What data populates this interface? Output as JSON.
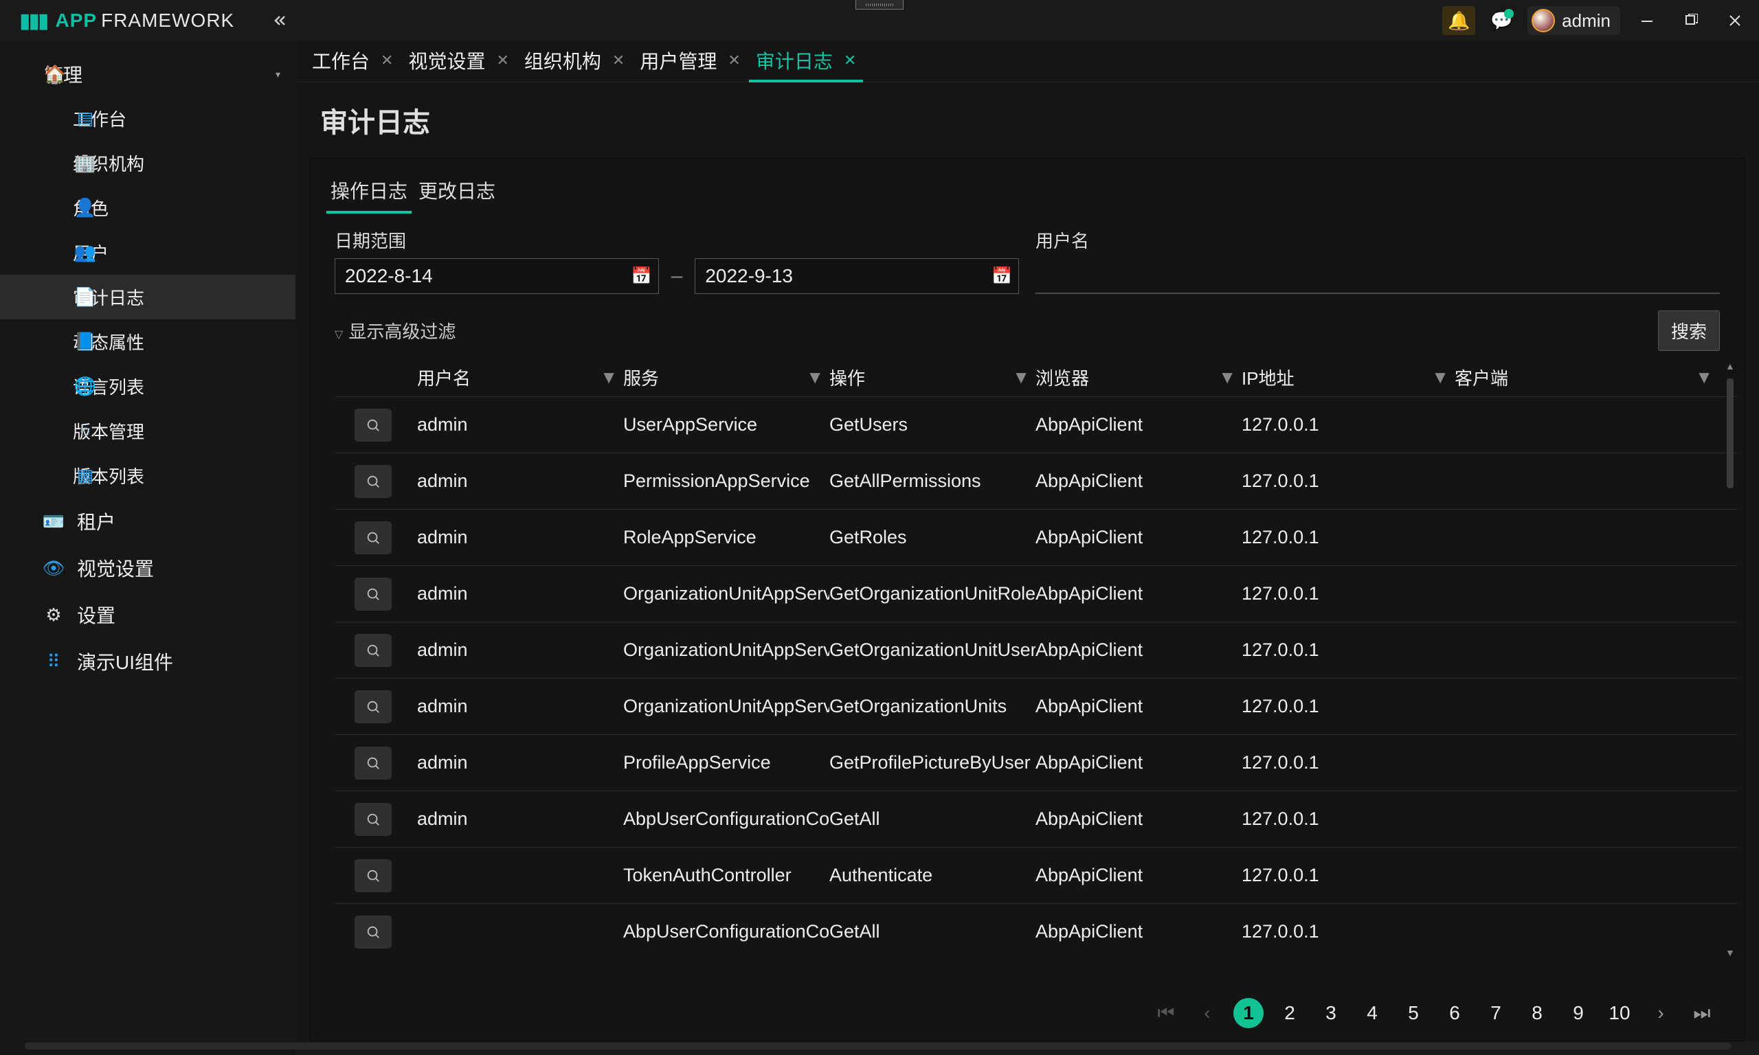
{
  "header": {
    "app_name": "APP",
    "app_suffix": "FRAMEWORK",
    "user": "admin"
  },
  "sidebar": {
    "group": {
      "label": "管理"
    },
    "items": [
      {
        "label": "工作台"
      },
      {
        "label": "组织机构"
      },
      {
        "label": "角色"
      },
      {
        "label": "用户"
      },
      {
        "label": "审计日志"
      },
      {
        "label": "动态属性"
      },
      {
        "label": "语言列表"
      },
      {
        "label": "版本管理"
      },
      {
        "label": "版本列表"
      }
    ],
    "level1": [
      {
        "label": "租户"
      },
      {
        "label": "视觉设置"
      },
      {
        "label": "设置"
      },
      {
        "label": "演示UI组件"
      }
    ]
  },
  "tabs": [
    {
      "label": "工作台"
    },
    {
      "label": "视觉设置"
    },
    {
      "label": "组织机构"
    },
    {
      "label": "用户管理"
    },
    {
      "label": "审计日志",
      "active": true
    }
  ],
  "page": {
    "title": "审计日志",
    "subtabs": [
      {
        "label": "操作日志",
        "active": true
      },
      {
        "label": "更改日志"
      }
    ],
    "filters": {
      "date_label": "日期范围",
      "date_from": "2022-8-14",
      "date_separator": "–",
      "date_to": "2022-9-13",
      "user_label": "用户名",
      "user_value": "",
      "advanced_label": "显示高级过滤",
      "search_label": "搜索"
    },
    "columns": {
      "user": "用户名",
      "service": "服务",
      "operation": "操作",
      "browser": "浏览器",
      "ip": "IP地址",
      "client": "客户端"
    },
    "rows": [
      {
        "user": "admin",
        "service": "UserAppService",
        "operation": "GetUsers",
        "browser": "AbpApiClient",
        "ip": "127.0.0.1",
        "client": ""
      },
      {
        "user": "admin",
        "service": "PermissionAppService",
        "operation": "GetAllPermissions",
        "browser": "AbpApiClient",
        "ip": "127.0.0.1",
        "client": ""
      },
      {
        "user": "admin",
        "service": "RoleAppService",
        "operation": "GetRoles",
        "browser": "AbpApiClient",
        "ip": "127.0.0.1",
        "client": ""
      },
      {
        "user": "admin",
        "service": "OrganizationUnitAppService",
        "operation": "GetOrganizationUnitRoles",
        "browser": "AbpApiClient",
        "ip": "127.0.0.1",
        "client": ""
      },
      {
        "user": "admin",
        "service": "OrganizationUnitAppService",
        "operation": "GetOrganizationUnitUsers",
        "browser": "AbpApiClient",
        "ip": "127.0.0.1",
        "client": ""
      },
      {
        "user": "admin",
        "service": "OrganizationUnitAppService",
        "operation": "GetOrganizationUnits",
        "browser": "AbpApiClient",
        "ip": "127.0.0.1",
        "client": ""
      },
      {
        "user": "admin",
        "service": "ProfileAppService",
        "operation": "GetProfilePictureByUser",
        "browser": "AbpApiClient",
        "ip": "127.0.0.1",
        "client": ""
      },
      {
        "user": "admin",
        "service": "AbpUserConfigurationController",
        "operation": "GetAll",
        "browser": "AbpApiClient",
        "ip": "127.0.0.1",
        "client": ""
      },
      {
        "user": "",
        "service": "TokenAuthController",
        "operation": "Authenticate",
        "browser": "AbpApiClient",
        "ip": "127.0.0.1",
        "client": ""
      },
      {
        "user": "",
        "service": "AbpUserConfigurationController",
        "operation": "GetAll",
        "browser": "AbpApiClient",
        "ip": "127.0.0.1",
        "client": ""
      }
    ],
    "pager": {
      "current": 1,
      "pages": [
        "1",
        "2",
        "3",
        "4",
        "5",
        "6",
        "7",
        "8",
        "9",
        "10"
      ]
    }
  }
}
